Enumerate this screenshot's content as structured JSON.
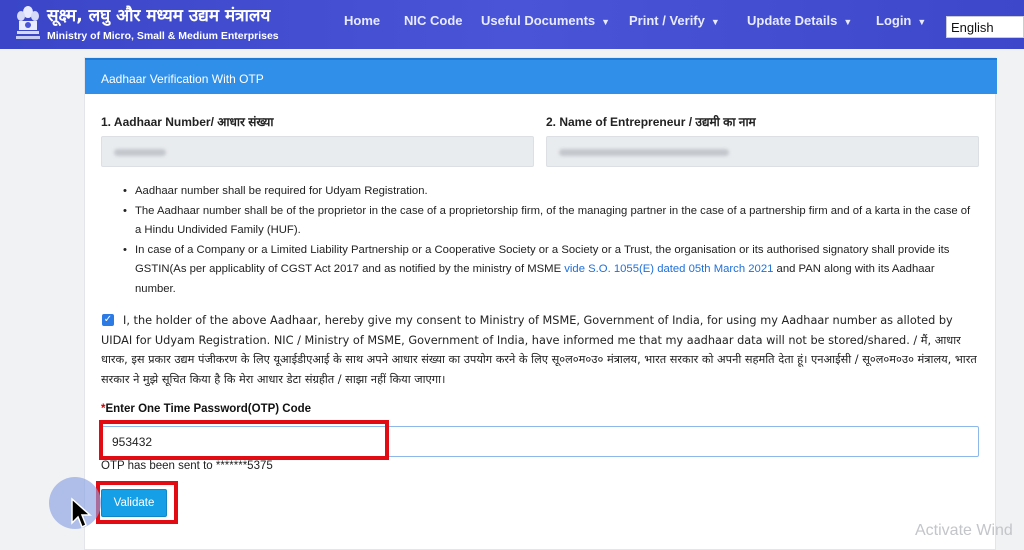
{
  "header": {
    "brand_hindi": "सूक्ष्म, लघु और मध्यम उद्यम मंत्रालय",
    "brand_english": "Ministry of Micro, Small & Medium Enterprises",
    "nav": [
      {
        "label": "Home"
      },
      {
        "label": "NIC Code"
      },
      {
        "label": "Useful Documents"
      },
      {
        "label": "Print / Verify"
      },
      {
        "label": "Update Details"
      },
      {
        "label": "Login"
      }
    ],
    "language": "English"
  },
  "card": {
    "title": "Aadhaar Verification With OTP",
    "aadhaar_label": "1. Aadhaar Number/ आधार संख्या",
    "name_label": "2. Name of Entrepreneur / उद्यमी का नाम",
    "notes": [
      "Aadhaar number shall be required for Udyam Registration.",
      "The Aadhaar number shall be of the proprietor in the case of a proprietorship firm, of the managing partner in the case of a partnership firm and of a karta in the case of a Hindu Undivided Family (HUF).",
      "In case of a Company or a Limited Liability Partnership or a Cooperative Society or a Society or a Trust, the organisation or its authorised signatory shall provide its GSTIN(As per applicablity of CGST Act 2017 and as notified by the ministry of MSME"
    ],
    "note3_link": "vide S.O. 1055(E) dated 05th March 2021",
    "note3_tail": "and PAN along with its Aadhaar number.",
    "consent_text": "I, the holder of the above Aadhaar, hereby give my consent to Ministry of MSME, Government of India, for using my Aadhaar number as alloted by UIDAI for Udyam Registration. NIC / Ministry of MSME, Government of India, have informed me that my aadhaar data will not be stored/shared. / मैं, आधार धारक, इस प्रकार उद्यम पंजीकरण के लिए यूआईडीएआई के साथ अपने आधार संख्या का उपयोग करने के लिए सू०ल०म०उ० मंत्रालय, भारत सरकार को अपनी सहमति देता हूं। एनआईसी / सू०ल०म०उ० मंत्रालय, भारत सरकार ने मुझे सूचित किया है कि मेरा आधार डेटा संग्रहीत / साझा नहीं किया जाएगा।",
    "otp_required_mark": "*",
    "otp_label": "Enter One Time Password(OTP) Code",
    "otp_value": "953432",
    "otp_sent_text": "OTP has been sent to *******5375",
    "validate_label": "Validate"
  },
  "watermark": "Activate Wind",
  "colors": {
    "navbar": "#4a54d6",
    "card_header": "#2f8fe9",
    "highlight": "#e20b14",
    "button": "#159fe6",
    "link": "#1e6fd9"
  }
}
